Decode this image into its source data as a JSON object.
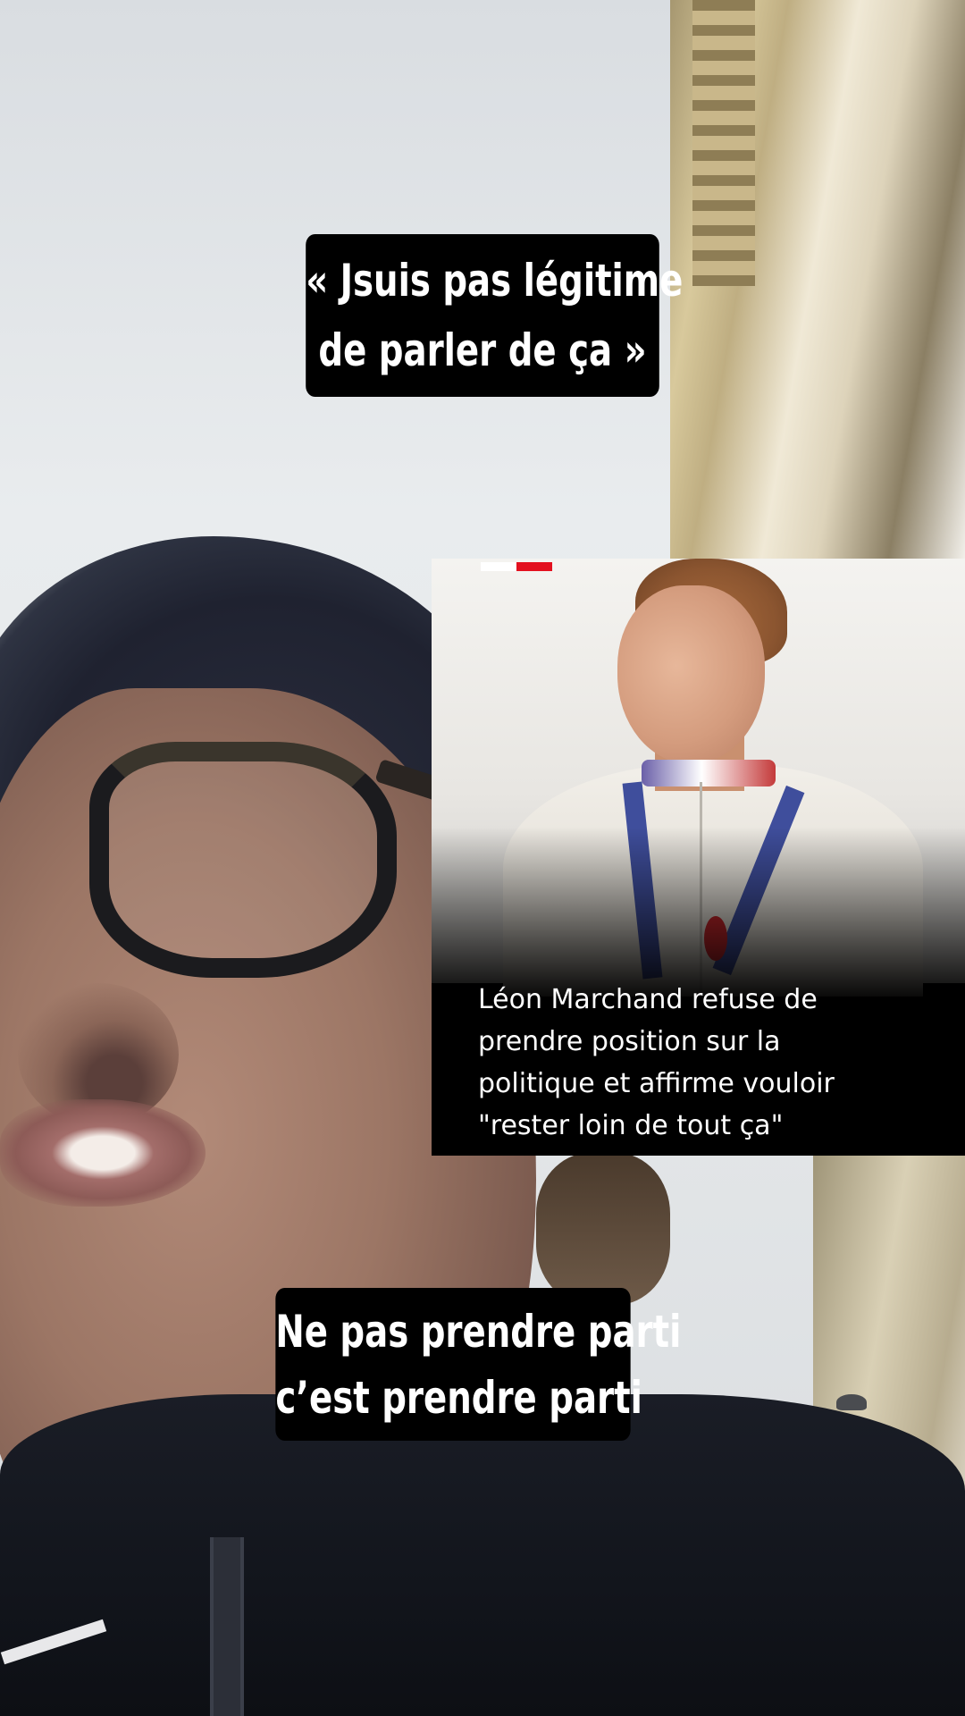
{
  "captions": {
    "top": {
      "line1": "« Jsuis pas légitime",
      "line2": "de parler de ça »"
    },
    "bottom": {
      "line1": "Ne pas prendre parti",
      "line2": "c’est prendre parti"
    }
  },
  "news_card": {
    "headline_lines": [
      "Léon Marchand refuse de",
      "prendre position sur la",
      "politique et affirme vouloir",
      "\"rester loin de tout ça\""
    ],
    "flag_colors": [
      "#ffffff",
      "#e3101f"
    ]
  }
}
